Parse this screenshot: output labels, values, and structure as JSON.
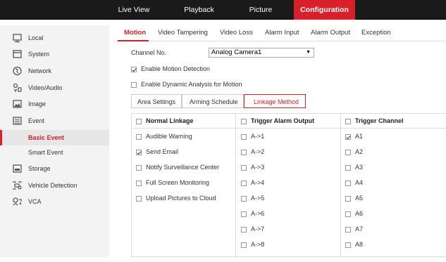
{
  "topnav": {
    "live_view": "Live View",
    "playback": "Playback",
    "picture": "Picture",
    "configuration": "Configuration"
  },
  "sidebar": {
    "local": "Local",
    "system": "System",
    "network": "Network",
    "video_audio": "Video/Audio",
    "image": "Image",
    "event": "Event",
    "basic_event": "Basic Event",
    "smart_event": "Smart Event",
    "storage": "Storage",
    "vehicle_detection": "Vehicle Detection",
    "vca": "VCA"
  },
  "tabs": {
    "motion": "Motion",
    "video_tampering": "Video Tampering",
    "video_loss": "Video Loss",
    "alarm_input": "Alarm Input",
    "alarm_output": "Alarm Output",
    "exception": "Exception"
  },
  "form": {
    "channel_label": "Channel No.",
    "channel_value": "Analog Camera1",
    "enable_motion": "Enable Motion Detection",
    "enable_motion_checked": true,
    "enable_dynamic": "Enable Dynamic Analysis for Motion",
    "enable_dynamic_checked": false
  },
  "subtabs": {
    "area_settings": "Area Settings",
    "arming_schedule": "Arming Schedule",
    "linkage_method": "Linkage Method"
  },
  "linkage": {
    "normal_header": "Normal Linkage",
    "normal": [
      {
        "label": "Audible Warning",
        "checked": false
      },
      {
        "label": "Send Email",
        "checked": true
      },
      {
        "label": "Notify Surveillance Center",
        "checked": false
      },
      {
        "label": "Full Screen Monitoring",
        "checked": false
      },
      {
        "label": "Upload Pictures to Cloud",
        "checked": false
      }
    ],
    "alarm_header": "Trigger Alarm Output",
    "alarm": [
      "A->1",
      "A->2",
      "A->3",
      "A->4",
      "A->5",
      "A->6",
      "A->7",
      "A->8"
    ],
    "channel_header": "Trigger Channel",
    "channel": [
      {
        "label": "A1",
        "checked": true
      },
      {
        "label": "A2",
        "checked": false
      },
      {
        "label": "A3",
        "checked": false
      },
      {
        "label": "A4",
        "checked": false
      },
      {
        "label": "A5",
        "checked": false
      },
      {
        "label": "A6",
        "checked": false
      },
      {
        "label": "A7",
        "checked": false
      },
      {
        "label": "A8",
        "checked": false
      }
    ]
  },
  "colors": {
    "accent": "#d9202a",
    "topbar": "#1a1a1a",
    "sidebar_bg": "#f3f3f3"
  }
}
